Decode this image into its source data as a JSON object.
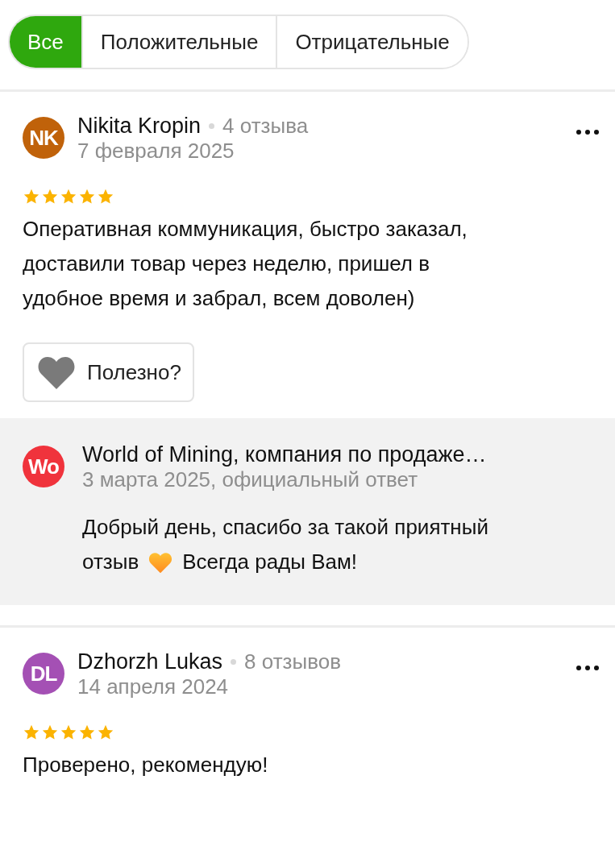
{
  "tabs": [
    {
      "label": "Все",
      "selected": true
    },
    {
      "label": "Положительные",
      "selected": false
    },
    {
      "label": "Отрицательные",
      "selected": false
    }
  ],
  "reviews": [
    {
      "initials": "NK",
      "color": "#c0620a",
      "author": "Nikita Kropin",
      "count": "4 отзыва",
      "date": "7 февраля 2025",
      "stars": 5,
      "text": "Оперативная коммуникация, быстро заказал,\nдоставили товар через неделю, пришел в\nудобное время и забрал, всем доволен)",
      "helpful": "Полезно?",
      "reply": {
        "initials": "Wo",
        "color": "#f0333c",
        "author": "World of Mining, компания по продаже…",
        "date": "3 марта 2025, официальный ответ",
        "text_parts": [
          "Добрый день, спасибо за такой приятный",
          "отзыв",
          "Всегда рады Вам!"
        ]
      }
    },
    {
      "initials": "DL",
      "color": "#a450b4",
      "author": "Dzhorzh Lukas",
      "count": "8 отзывов",
      "date": "14 апреля 2024",
      "stars": 5,
      "text": "Проверено, рекомендую!"
    }
  ]
}
